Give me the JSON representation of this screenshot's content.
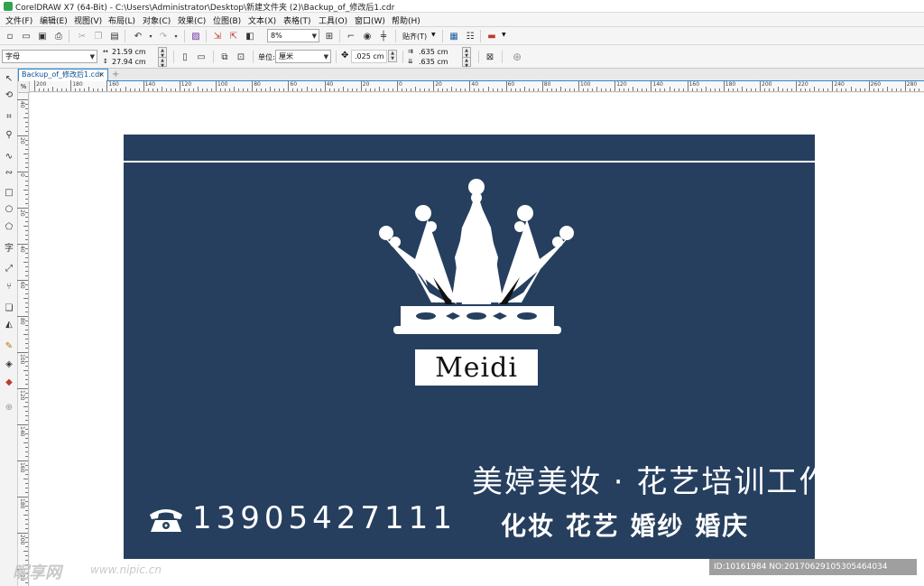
{
  "window": {
    "title": "CorelDRAW X7 (64-Bit) - C:\\Users\\Administrator\\Desktop\\新建文件夹 (2)\\Backup_of_修改后1.cdr"
  },
  "menu": [
    "文件(F)",
    "编辑(E)",
    "视图(V)",
    "布局(L)",
    "对象(C)",
    "效果(C)",
    "位图(B)",
    "文本(X)",
    "表格(T)",
    "工具(O)",
    "窗口(W)",
    "帮助(H)"
  ],
  "toolbar": {
    "zoom": "8%",
    "snap_label": "贴齐(T)"
  },
  "property_bar": {
    "paper_preset": "字母",
    "width": "21.59 cm",
    "height": "27.94 cm",
    "units_label": "单位:",
    "units_value": "厘米",
    "nudge": ".025 cm",
    "dup_x": ".635 cm",
    "dup_y": ".635 cm"
  },
  "document_tab": {
    "name": "Backup_of_修改后1.cdr",
    "close": "×",
    "add": "+"
  },
  "ruler": {
    "h_labels": [
      "200",
      "180",
      "160",
      "140",
      "120",
      "100",
      "80",
      "60",
      "40",
      "20",
      "0",
      "20",
      "40",
      "60",
      "80",
      "100",
      "120",
      "140",
      "160",
      "180",
      "200",
      "220",
      "240",
      "260",
      "280"
    ],
    "v_labels": [
      "40",
      "20",
      "0",
      "20",
      "40",
      "60",
      "80",
      "100",
      "120",
      "140",
      "160",
      "180",
      "200",
      "220",
      "240",
      "260"
    ],
    "corner": "%"
  },
  "card": {
    "background_color": "#263f5e",
    "logo_text": "Meidi",
    "studio_name": "美婷美妆 · 花艺培训工作室",
    "services": "化妆  花艺  婚纱  婚庆",
    "phone": "13905427111"
  },
  "watermark": {
    "site": "昵享网",
    "url": "www.nipic.cn",
    "id_text": "ID:10161984 NO:20170629105305464034"
  }
}
